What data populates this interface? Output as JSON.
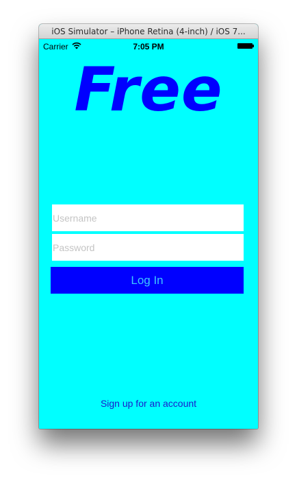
{
  "window": {
    "title": "iOS Simulator – iPhone Retina (4-inch) / iOS 7..."
  },
  "status_bar": {
    "carrier": "Carrier",
    "time": "7:05 PM"
  },
  "logo": {
    "text": "Free",
    "color": "#0000ff"
  },
  "login_form": {
    "username_placeholder": "Username",
    "password_placeholder": "Password",
    "login_label": "Log In"
  },
  "signup_link": "Sign up for an account",
  "colors": {
    "background": "#00ffff",
    "button": "#0000ff",
    "button_text": "#3ec8ff",
    "link": "#1a1acc"
  }
}
